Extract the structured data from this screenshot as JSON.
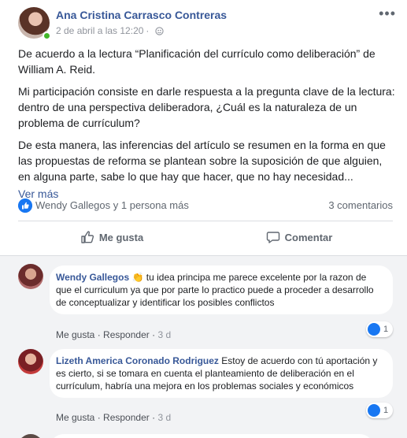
{
  "post": {
    "author": "Ana Cristina Carrasco Contreras",
    "date": "2 de abril a las 12:20",
    "separator": "·",
    "paragraphs": [
      "De acuerdo a la lectura “Planificación del currículo como deliberación” de William A. Reid.",
      "Mi participación consiste en darle respuesta a la pregunta clave de la lectura: dentro de una perspectiva deliberadora, ¿Cuál es la naturaleza de un problema de currículum?",
      "De esta manera, las inferencias del artículo se resumen en la forma en que las propuestas de reforma se plantean sobre la suposición de que alguien, en alguna parte, sabe lo que hay que hacer, que no hay necesidad..."
    ],
    "see_more": "Ver más",
    "options": "•••"
  },
  "reactions": {
    "names": "Wendy Gallegos y 1 persona más",
    "comments": "3 comentarios"
  },
  "actions": {
    "like": "Me gusta",
    "comment": "Comentar"
  },
  "comments": [
    {
      "name": "Wendy Gallegos",
      "emoji": "👏",
      "text": "tu idea principa me parece excelente por la razon de que el curriculum ya que por parte lo practico puede a proceder a desarrollo de conceptualizar y identificar los posibles conflictos",
      "like": "Me gusta",
      "reply": "Responder",
      "age": "3 d",
      "likes": "1"
    },
    {
      "name": "Lizeth America Coronado Rodriguez",
      "text": "Estoy de acuerdo con tú aportación y es cierto, si se tomara en cuenta el planteamiento de deliberación en el currículum, habría una mejora en los problemas sociales y económicos",
      "like": "Me gusta",
      "reply": "Responder",
      "age": "3 d",
      "likes": "1"
    }
  ],
  "dot": "·",
  "colors": {
    "link": "#385898",
    "brand": "#1877f2",
    "online": "#42b72a"
  }
}
